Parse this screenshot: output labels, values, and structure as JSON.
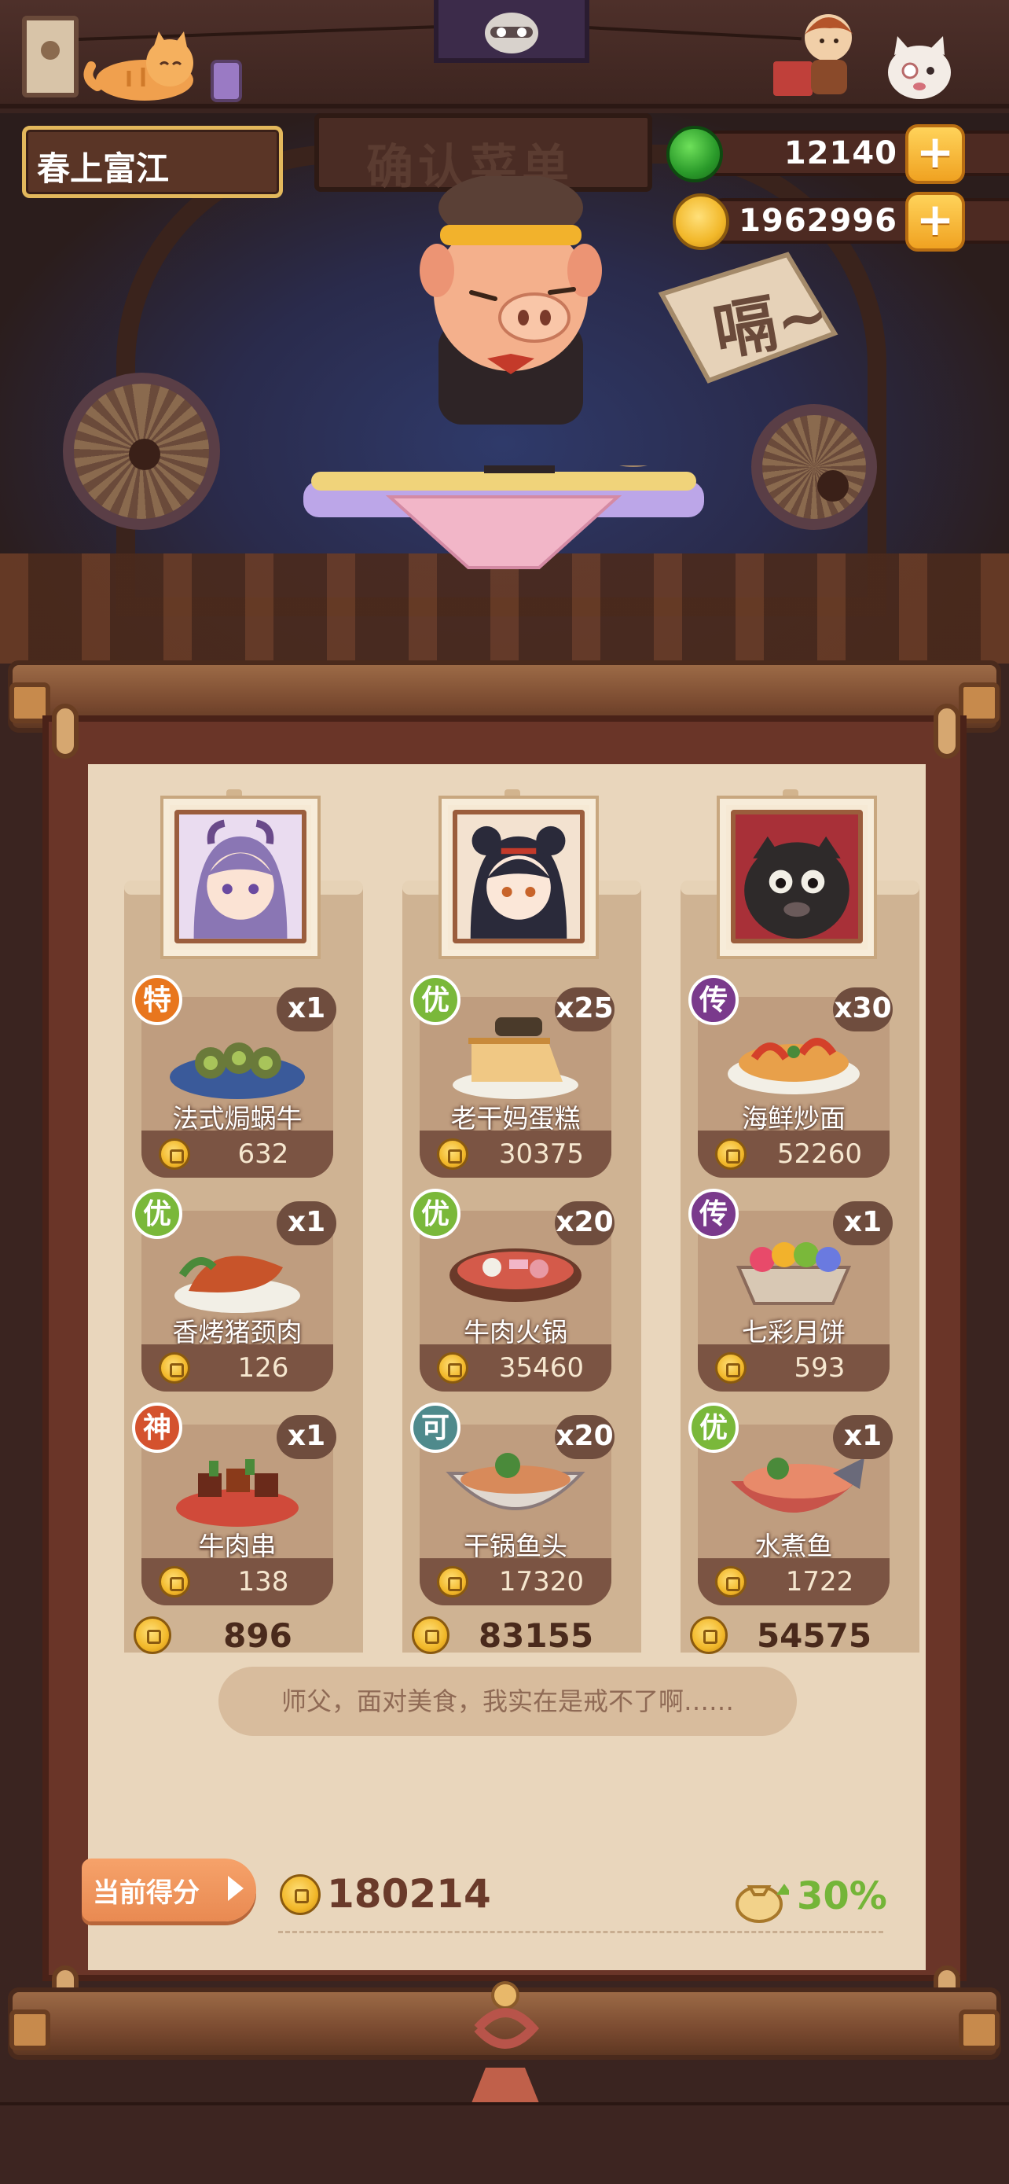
{
  "player": {
    "name": "春上富江"
  },
  "currency": {
    "jade": {
      "value": "12140",
      "icon": "green-jade-icon",
      "plus": "+"
    },
    "gold": {
      "value": "1962996",
      "icon": "gold-coin-icon",
      "plus": "+"
    }
  },
  "scene": {
    "sign_text": "嗝~",
    "banner_text": "确认菜单"
  },
  "columns": [
    {
      "customer": "purple-haired-girl-portrait",
      "dishes": [
        {
          "grade": "特",
          "grade_color": "#e8761e",
          "name": "法式焗蜗牛",
          "qty": "x1",
          "price": "632",
          "icon": "escargot-dish-icon"
        },
        {
          "grade": "优",
          "grade_color": "#7ab83a",
          "name": "香烤猪颈肉",
          "qty": "x1",
          "price": "126",
          "icon": "roast-pork-dish-icon"
        },
        {
          "grade": "神",
          "grade_color": "#d4522e",
          "name": "牛肉串",
          "qty": "x1",
          "price": "138",
          "icon": "beef-skewer-dish-icon"
        }
      ],
      "total": "896"
    },
    {
      "customer": "black-haired-girl-portrait",
      "dishes": [
        {
          "grade": "优",
          "grade_color": "#7ab83a",
          "name": "老干妈蛋糕",
          "qty": "x25",
          "price": "30375",
          "icon": "cake-dish-icon"
        },
        {
          "grade": "优",
          "grade_color": "#7ab83a",
          "name": "牛肉火锅",
          "qty": "x20",
          "price": "35460",
          "icon": "hotpot-dish-icon"
        },
        {
          "grade": "可",
          "grade_color": "#4f8a8c",
          "name": "干锅鱼头",
          "qty": "x20",
          "price": "17320",
          "icon": "fish-head-dish-icon"
        }
      ],
      "total": "83155"
    },
    {
      "customer": "black-dog-portrait",
      "dishes": [
        {
          "grade": "传",
          "grade_color": "#7a3a8c",
          "name": "海鲜炒面",
          "qty": "x30",
          "price": "52260",
          "icon": "seafood-noodles-dish-icon"
        },
        {
          "grade": "传",
          "grade_color": "#7a3a8c",
          "name": "七彩月饼",
          "qty": "x1",
          "price": "593",
          "icon": "mooncake-dish-icon"
        },
        {
          "grade": "优",
          "grade_color": "#7ab83a",
          "name": "水煮鱼",
          "qty": "x1",
          "price": "1722",
          "icon": "boiled-fish-dish-icon"
        }
      ],
      "total": "54575"
    }
  ],
  "quote": "师父，面对美食，我实在是戒不了啊……",
  "score": {
    "label": "当前得分",
    "value": "180214",
    "bonus": "30%"
  }
}
